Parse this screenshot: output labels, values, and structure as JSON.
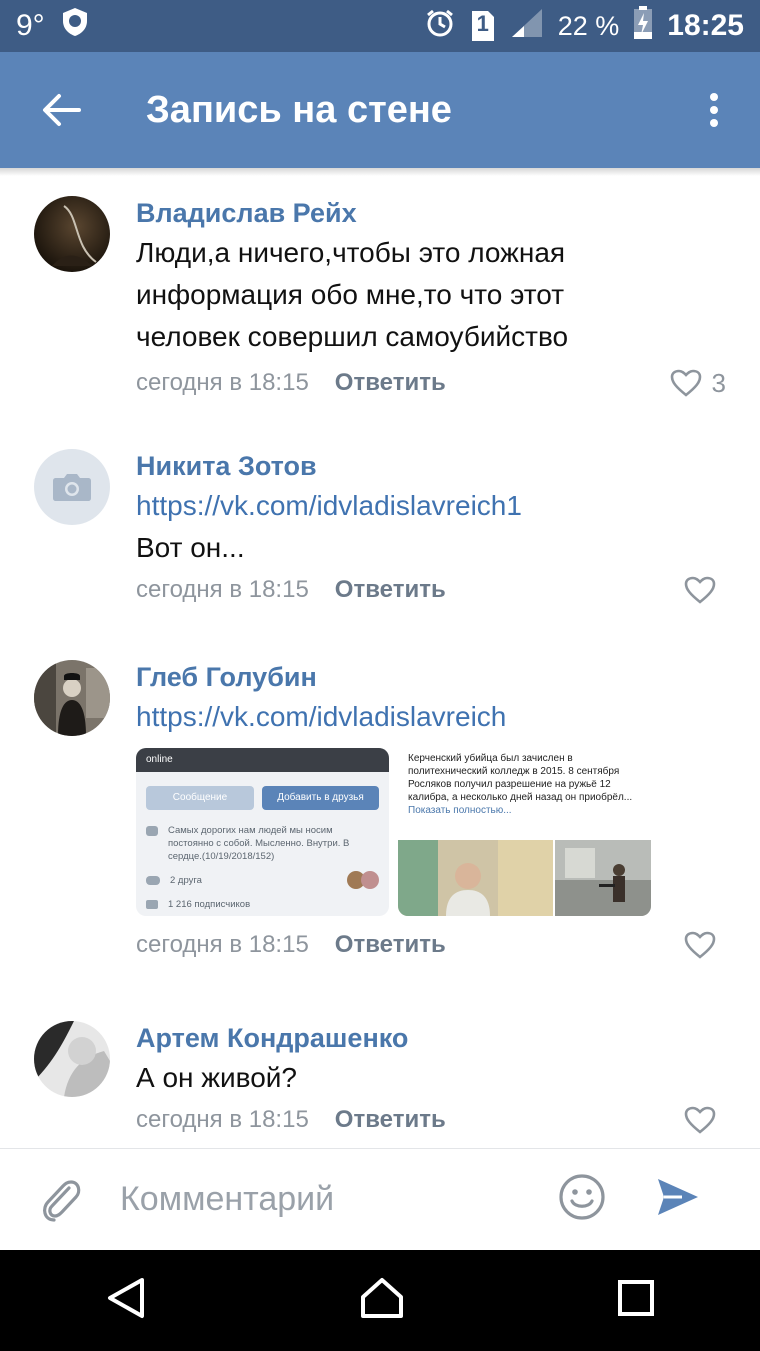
{
  "status": {
    "temperature": "9°",
    "sim": "1",
    "battery": "22 %",
    "time": "18:25"
  },
  "header": {
    "title": "Запись на стене"
  },
  "comments": [
    {
      "author": "Владислав Рейх",
      "text": "Люди,а ничего,чтобы это ложная информация обо мне,то что этот человек совершил самоубийство",
      "date": "сегодня в 18:15",
      "reply": "Ответить",
      "likes": "3"
    },
    {
      "author": "Никита Зотов",
      "link": "https://vk.com/idvladislavreich1",
      "text": "Вот он...",
      "date": "сегодня в 18:15",
      "reply": "Ответить"
    },
    {
      "author": "Глеб Голубин",
      "link": "https://vk.com/idvladislavreich",
      "date": "сегодня в 18:15",
      "reply": "Ответить",
      "attachment1": {
        "status": "online",
        "btn_message": "Сообщение",
        "btn_add": "Добавить в друзья",
        "quote": "Самых дорогих нам людей мы носим постоянно с собой. Мысленно. Внутри. В сердце.(10/19/2018/152)",
        "friends": "2 друга",
        "subscribers": "1 216 подписчиков"
      },
      "attachment2": {
        "text": "Керченский убийца был зачислен в политехнический колледж в 2015. 8 сентября Росляков получил разрешение на ружьё 12 калибра, а несколько дней назад он приобрёл...",
        "more": "Показать полностью..."
      }
    },
    {
      "author": "Артем Кондрашенко",
      "text": "А он живой?",
      "date": "сегодня в 18:15",
      "reply": "Ответить"
    }
  ],
  "composer": {
    "placeholder": "Комментарий"
  }
}
